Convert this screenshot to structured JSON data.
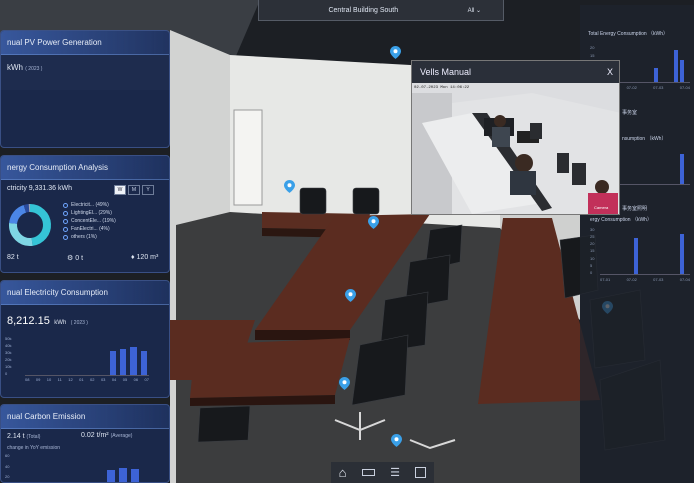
{
  "topbar": {
    "location": "Central Building South",
    "filter": "All"
  },
  "left": {
    "pv": {
      "title": "nual PV Power Generation",
      "unit": "kWh",
      "year": "( 2023 )"
    },
    "energy": {
      "title": "nergy Consumption Analysis",
      "total": "ctricity 9,331.36 kWh",
      "periods": [
        "W",
        "M",
        "Y"
      ],
      "legend": [
        "Electricit... (49%)",
        "LightingEl... (29%)",
        "ConcentEle... (19%)",
        "FanElectri... (4%)",
        "others (1%)"
      ],
      "shares": [
        49,
        29,
        19,
        4,
        1
      ],
      "colors": [
        "#35c4d6",
        "#7fd6e4",
        "#4b86e6",
        "#2a4a9c",
        "#9ba6b8"
      ],
      "stat1": "82 t",
      "stat2": "0 t",
      "stat3": "120 m³"
    },
    "electricity": {
      "title": "nual Electricity Consumption",
      "value": "8,212.15",
      "unit": "kWh",
      "year": "( 2023 )",
      "yticks": [
        "50k",
        "40k",
        "30k",
        "20k",
        "10k",
        "0"
      ],
      "months": [
        "08",
        "09",
        "10",
        "11",
        "12",
        "01",
        "02",
        "03",
        "04",
        "05",
        "06",
        "07"
      ],
      "levels": [
        0,
        0,
        0,
        0,
        0,
        0,
        0,
        0,
        0.6,
        0.65,
        0.7,
        0.6
      ]
    },
    "carbon": {
      "title": "nual Carbon Emission",
      "total_value": "2.14 t",
      "total_label": "(Total)",
      "avg_value": "0.02 t/m²",
      "avg_label": "(Average)",
      "change": "change in YoY emission",
      "yticks": [
        "60",
        "40",
        "20"
      ],
      "levels": [
        0.6,
        0.7,
        0.65
      ]
    }
  },
  "video": {
    "title": "Vells Manual",
    "close": "X",
    "stamp": "02-07-2023 Mon 14:06:22",
    "label": "Camera"
  },
  "right": {
    "title1": "Total Energy Consumption （kWh）",
    "ticks1": [
      "20",
      "15",
      "10",
      "5",
      "0"
    ],
    "xl1": [
      "07-01",
      "07-02",
      "07-03",
      "07-04"
    ],
    "lbl_a": "事务室",
    "lbl_b": "nsumption （kWh）",
    "lbl_c": "事务室照明",
    "title3": "ergy Consumption （kWh）",
    "ticks3": [
      "30",
      "25",
      "20",
      "15",
      "10",
      "5",
      "0"
    ],
    "xl3": [
      "07-01",
      "07-02",
      "07-03",
      "07-04"
    ]
  },
  "toolbar": {
    "icons": [
      "home-icon",
      "ruler-icon",
      "list-icon",
      "fullscreen-icon"
    ]
  },
  "colors": {
    "accent": "#3d63d6",
    "pin": "#3aa0e8",
    "panel": "#1a2a50"
  }
}
